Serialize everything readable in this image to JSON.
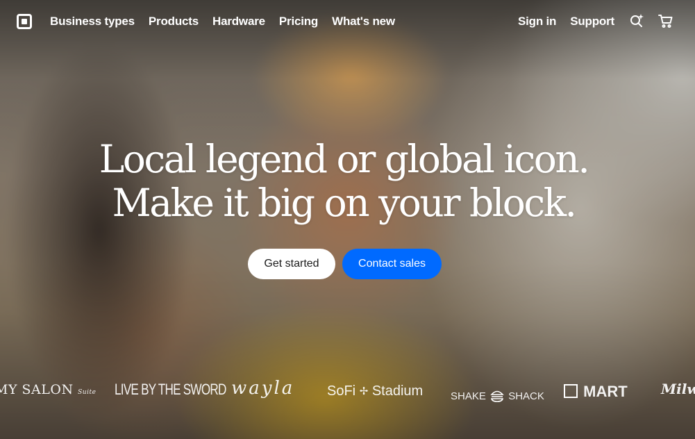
{
  "brand": {
    "logo_icon": "square-logo-icon"
  },
  "nav": {
    "left": [
      {
        "label": "Business types"
      },
      {
        "label": "Products"
      },
      {
        "label": "Hardware"
      },
      {
        "label": "Pricing"
      },
      {
        "label": "What's new"
      }
    ],
    "right": [
      {
        "label": "Sign in"
      },
      {
        "label": "Support"
      }
    ],
    "icons": [
      "ai-search-sparkle-icon",
      "shopping-cart-icon"
    ]
  },
  "hero": {
    "headline_line1": "Local legend or global icon.",
    "headline_line2": "Make it big on your block.",
    "primary_cta": "Get started",
    "secondary_cta": "Contact sales"
  },
  "customer_logos": {
    "salon": "MY SALON",
    "salon_sub": "Suite",
    "sword": "LIVE BY THE SWORD",
    "wayla": "wayla",
    "sofi": "SoFi",
    "sofi_suffix": "Stadium",
    "shake": "SHAKE",
    "shake_suffix": "SHACK",
    "hmart": "MART",
    "milwaukee": "Milw"
  },
  "colors": {
    "primary_blue": "#006aff",
    "white": "#ffffff"
  }
}
